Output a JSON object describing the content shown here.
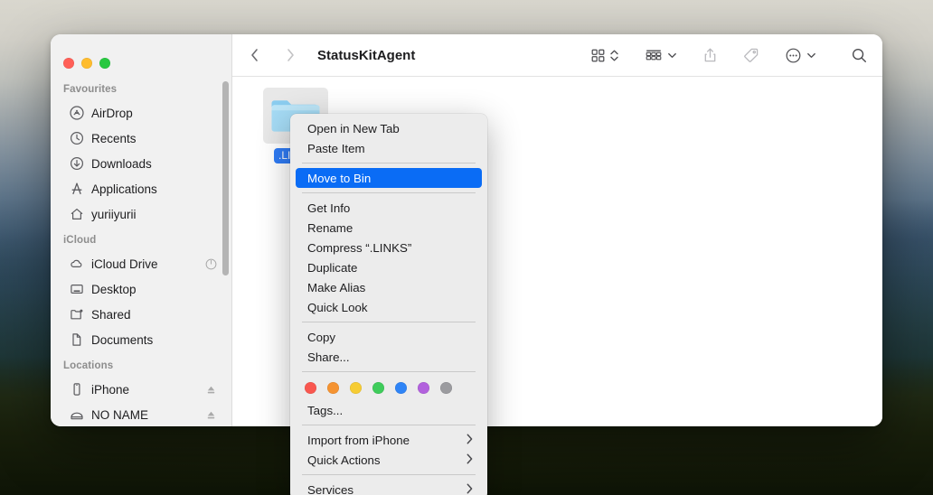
{
  "window": {
    "title": "StatusKitAgent",
    "traffic_lights": [
      {
        "name": "close",
        "color": "#ff5f57"
      },
      {
        "name": "minimize",
        "color": "#febc2e"
      },
      {
        "name": "zoom",
        "color": "#28c840"
      }
    ]
  },
  "toolbar": {
    "back_label": "Back",
    "forward_label": "Forward",
    "title": "StatusKitAgent",
    "group_label": "Group items",
    "view_label": "View options",
    "share_label": "Share",
    "tag_label": "Edit tags",
    "more_label": "More",
    "search_label": "Search"
  },
  "sidebar": {
    "groups": [
      {
        "title": "Favourites",
        "items": [
          {
            "label": "AirDrop",
            "icon": "airdrop-icon",
            "trailing": ""
          },
          {
            "label": "Recents",
            "icon": "clock-icon",
            "trailing": ""
          },
          {
            "label": "Downloads",
            "icon": "download-icon",
            "trailing": ""
          },
          {
            "label": "Applications",
            "icon": "applications-icon",
            "trailing": ""
          },
          {
            "label": "yuriiyurii",
            "icon": "home-icon",
            "trailing": ""
          }
        ]
      },
      {
        "title": "iCloud",
        "items": [
          {
            "label": "iCloud Drive",
            "icon": "cloud-icon",
            "trailing": "progress-icon"
          },
          {
            "label": "Desktop",
            "icon": "desktop-icon",
            "trailing": ""
          },
          {
            "label": "Shared",
            "icon": "shared-folder-icon",
            "trailing": ""
          },
          {
            "label": "Documents",
            "icon": "document-icon",
            "trailing": ""
          }
        ]
      },
      {
        "title": "Locations",
        "items": [
          {
            "label": "iPhone",
            "icon": "iphone-icon",
            "trailing": "eject-icon"
          },
          {
            "label": "NO NAME",
            "icon": "drive-icon",
            "trailing": "eject-icon"
          }
        ]
      }
    ]
  },
  "content": {
    "file": {
      "name": ".LINKS",
      "icon": "folder-icon",
      "selected": true
    }
  },
  "context_menu": {
    "sections": [
      {
        "type": "items",
        "items": [
          {
            "label": "Open in New Tab",
            "selected": false,
            "submenu": false
          },
          {
            "label": "Paste Item",
            "selected": false,
            "submenu": false
          }
        ]
      },
      {
        "type": "items",
        "items": [
          {
            "label": "Move to Bin",
            "selected": true,
            "submenu": false
          }
        ]
      },
      {
        "type": "items",
        "items": [
          {
            "label": "Get Info",
            "selected": false,
            "submenu": false
          },
          {
            "label": "Rename",
            "selected": false,
            "submenu": false
          },
          {
            "label": "Compress “.LINKS”",
            "selected": false,
            "submenu": false
          },
          {
            "label": "Duplicate",
            "selected": false,
            "submenu": false
          },
          {
            "label": "Make Alias",
            "selected": false,
            "submenu": false
          },
          {
            "label": "Quick Look",
            "selected": false,
            "submenu": false
          }
        ]
      },
      {
        "type": "items",
        "items": [
          {
            "label": "Copy",
            "selected": false,
            "submenu": false
          },
          {
            "label": "Share...",
            "selected": false,
            "submenu": false
          }
        ]
      },
      {
        "type": "tags",
        "tag_colors": [
          "#f9574f",
          "#f59331",
          "#f6cc33",
          "#3fcc5b",
          "#2f84f6",
          "#b261dd",
          "#9b9b9f"
        ],
        "items": [
          {
            "label": "Tags...",
            "selected": false,
            "submenu": false
          }
        ]
      },
      {
        "type": "items",
        "items": [
          {
            "label": "Import from iPhone",
            "selected": false,
            "submenu": true
          },
          {
            "label": "Quick Actions",
            "selected": false,
            "submenu": true
          }
        ]
      },
      {
        "type": "items",
        "items": [
          {
            "label": "Services",
            "selected": false,
            "submenu": true
          }
        ]
      }
    ],
    "submenu_arrow": "›",
    "highlight_color": "#0a6cf5"
  }
}
